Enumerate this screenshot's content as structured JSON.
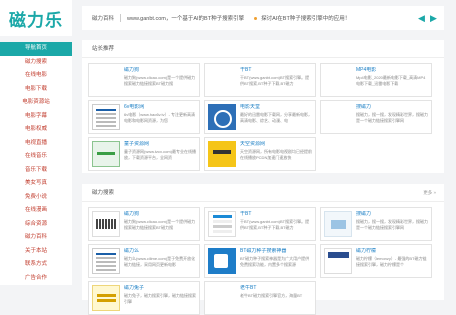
{
  "logo": {
    "text": "磁力乐"
  },
  "topbar": {
    "site_name": "磁力百科",
    "url_notice": "www.ganbt.com，一个基于AI的BT种子搜索引擎",
    "notice": "探讨AI在BT种子搜索引擎中的应用！"
  },
  "sidebar": {
    "items": [
      {
        "label": "导航首页",
        "active": true
      },
      {
        "label": "磁力搜索"
      },
      {
        "label": "在线电影"
      },
      {
        "label": "电影下载"
      },
      {
        "label": "电影资源站"
      },
      {
        "label": "电影字幕"
      },
      {
        "label": "电影权威"
      },
      {
        "label": "电视直播"
      },
      {
        "label": "在线音乐"
      },
      {
        "label": "音乐下载"
      },
      {
        "label": "美女写真"
      },
      {
        "label": "免费小说"
      },
      {
        "label": "在线漫画"
      },
      {
        "label": "综合资源"
      },
      {
        "label": "磁力百科"
      },
      {
        "label": "关于本站"
      },
      {
        "label": "联系方式"
      },
      {
        "label": "广告合作"
      }
    ]
  },
  "panel1": {
    "title": "站长推荐",
    "cards": [
      {
        "title": "磁力狗",
        "desc": "磁力狗(www.clicao.com)是一个提供磁力搜索磁力链接搜索BT磁力搜",
        "thumb": "t-blank"
      },
      {
        "title": "干BT",
        "desc": "干BT(www.ganbt.com)BT搜索引擎。提供BT搜索,BT种子下载,BT磁力",
        "thumb": "t-blank"
      },
      {
        "title": "MP4电影",
        "desc": "Mp4电影_2020最新电影下载_高清MP4电影下载_迅雷电影下载",
        "thumb": "t-blank"
      },
      {
        "title": "6v电影网",
        "desc": "6v电影（www.hao6v.tv）- 专注更新高清电影和电影网资源，为您",
        "thumb": "t-doc"
      },
      {
        "title": "电影天堂",
        "desc": "最好的迅雷电影下载网，分享最新电影，高清电影、综艺、动漫、电",
        "thumb": "t-blue"
      },
      {
        "title": "搜磁力",
        "desc": "搜磁力，搜一搜，发现精彩世界，搜磁力是一个磁力链接搜索引擎网",
        "thumb": "t-blank"
      },
      {
        "title": "童子资源网",
        "desc": "童子资源网(www.tzcx.com)最专业在线播放，下载资源平台，全网资",
        "thumb": "t-green"
      },
      {
        "title": "天空资源网",
        "desc": "天空资源网，所有电影电视剧均已经提前在线播放PCDN加速门速放快",
        "thumb": "t-yellow"
      }
    ]
  },
  "panel2": {
    "title": "磁力搜索",
    "more": "更多 »",
    "cards": [
      {
        "title": "磁力狗",
        "desc": "磁力狗(www.clicao.com)是一个提供磁力搜索磁力链接搜索BT磁力搜",
        "thumb": "t-white"
      },
      {
        "title": "干BT",
        "desc": "干BT(www.ganbt.com)BT搜索引擎。提供BT搜索,BT种子下载,BT磁力",
        "thumb": "t-stripe"
      },
      {
        "title": "搜磁力",
        "desc": "搜磁力，搜一搜，发现精彩世界，搜磁力是一个磁力链接搜索引擎网",
        "thumb": "t-light"
      },
      {
        "title": "磁力么",
        "desc": "磁力么(www.cilime.com)是于免费开放化磁力链接，采用网页更新电影",
        "thumb": "t-doc"
      },
      {
        "title": "BT磁力种子搜索神器",
        "desc": "BT磁力种子搜索神器是为广大用户提供免费搜索功能，内置多个搜索源",
        "thumb": "t-blue2"
      },
      {
        "title": "磁力柠檬",
        "desc": "磁力柠檬（lemonzy）- 最强的BT磁力链接搜索引擎，磁力柠檬是个",
        "thumb": "t-navy"
      },
      {
        "title": "磁力兔子",
        "desc": "磁力兔子，磁力搜索引擎，磁力链接搜索引擎",
        "thumb": "t-yellow2"
      },
      {
        "title": "老牛BT",
        "desc": "老牛BT磁力搜索引擎官方，海量BT",
        "thumb": "t-blank"
      }
    ]
  }
}
